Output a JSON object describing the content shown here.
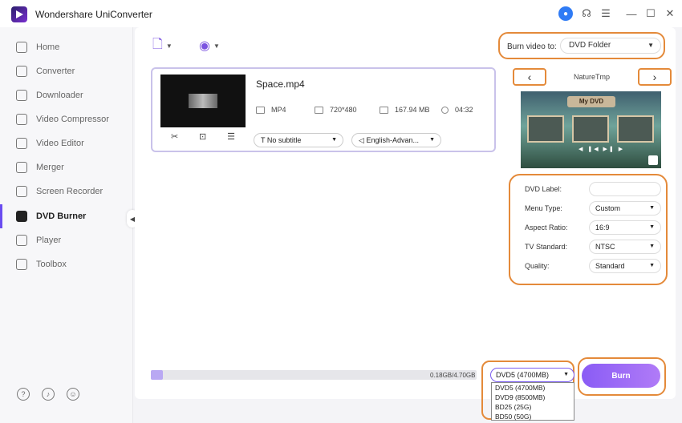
{
  "app": {
    "title": "Wondershare UniConverter"
  },
  "sidebar": {
    "items": [
      {
        "label": "Home",
        "icon": "home-icon"
      },
      {
        "label": "Converter",
        "icon": "converter-icon"
      },
      {
        "label": "Downloader",
        "icon": "downloader-icon"
      },
      {
        "label": "Video Compressor",
        "icon": "compress-icon"
      },
      {
        "label": "Video Editor",
        "icon": "edit-icon"
      },
      {
        "label": "Merger",
        "icon": "merge-icon"
      },
      {
        "label": "Screen Recorder",
        "icon": "record-icon"
      },
      {
        "label": "DVD Burner",
        "icon": "dvd-icon",
        "active": true
      },
      {
        "label": "Player",
        "icon": "play-icon"
      },
      {
        "label": "Toolbox",
        "icon": "toolbox-icon"
      }
    ]
  },
  "burn_to": {
    "label": "Burn video to:",
    "value": "DVD Folder"
  },
  "file": {
    "name": "Space.mp4",
    "format": "MP4",
    "resolution": "720*480",
    "size": "167.94 MB",
    "duration": "04:32",
    "subtitle": "No subtitle",
    "audio": "English-Advan..."
  },
  "template": {
    "name": "NatureTmp",
    "banner": "My DVD"
  },
  "settings": {
    "dvd_label": {
      "label": "DVD Label:",
      "value": ""
    },
    "menu_type": {
      "label": "Menu Type:",
      "value": "Custom"
    },
    "aspect_ratio": {
      "label": "Aspect Ratio:",
      "value": "16:9"
    },
    "tv_standard": {
      "label": "TV Standard:",
      "value": "NTSC"
    },
    "quality": {
      "label": "Quality:",
      "value": "Standard"
    }
  },
  "progress": {
    "text": "0.18GB/4.70GB",
    "fraction": 0.038
  },
  "disc": {
    "selected": "DVD5 (4700MB)",
    "options": [
      "DVD5 (4700MB)",
      "DVD9 (8500MB)",
      "BD25 (25G)",
      "BD50 (50G)"
    ]
  },
  "burn_button": {
    "label": "Burn"
  },
  "colors": {
    "accent": "#7a52e0",
    "highlight": "#e48a3a"
  }
}
